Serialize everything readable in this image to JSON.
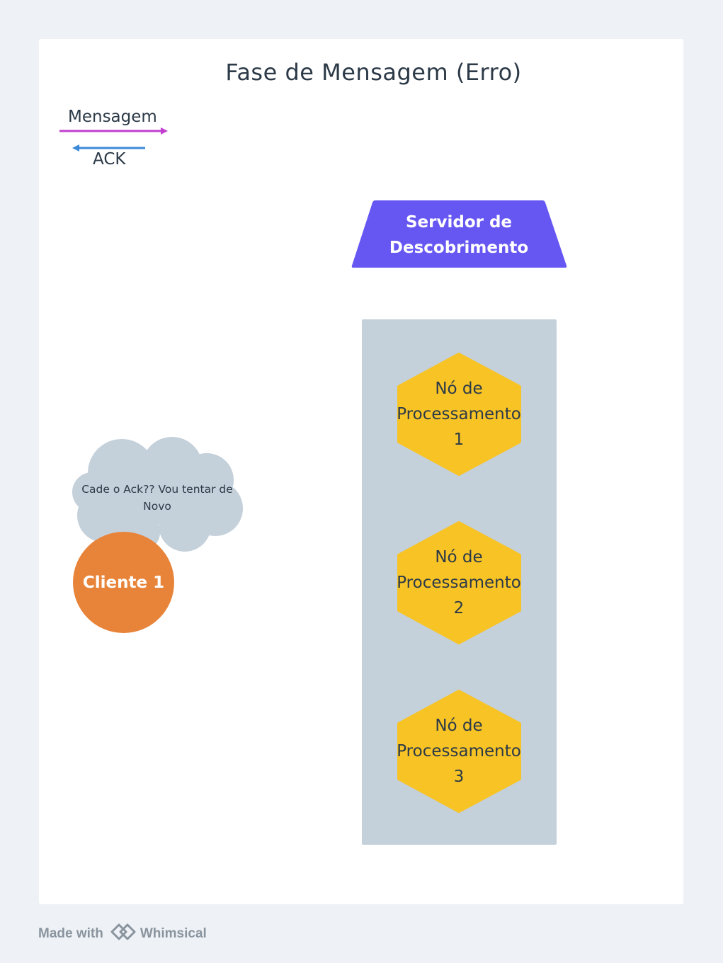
{
  "diagram": {
    "title": "Fase de Mensagem (Erro)",
    "legend": {
      "message_label": "Mensagem",
      "message_color": "#c03fcf",
      "ack_label": "ACK",
      "ack_color": "#3a8ad8"
    },
    "server": {
      "label": "Servidor de Descobrimento",
      "color": "#6657f2"
    },
    "processing_group_color": "#c4d0da",
    "processing_nodes": [
      {
        "label": "Nó de Processamento 1"
      },
      {
        "label": "Nó de Processamento 2"
      },
      {
        "label": "Nó de Processamento 3"
      }
    ],
    "node_color": "#f7c325",
    "cloud": {
      "text": "Cade o Ack?? Vou tentar de Novo",
      "color": "#c4d0da"
    },
    "client": {
      "label": "Cliente 1",
      "color": "#e8843a"
    }
  },
  "footer": {
    "made_with": "Made with",
    "brand": "Whimsical",
    "logo_icon": "whimsical-logo-icon"
  }
}
